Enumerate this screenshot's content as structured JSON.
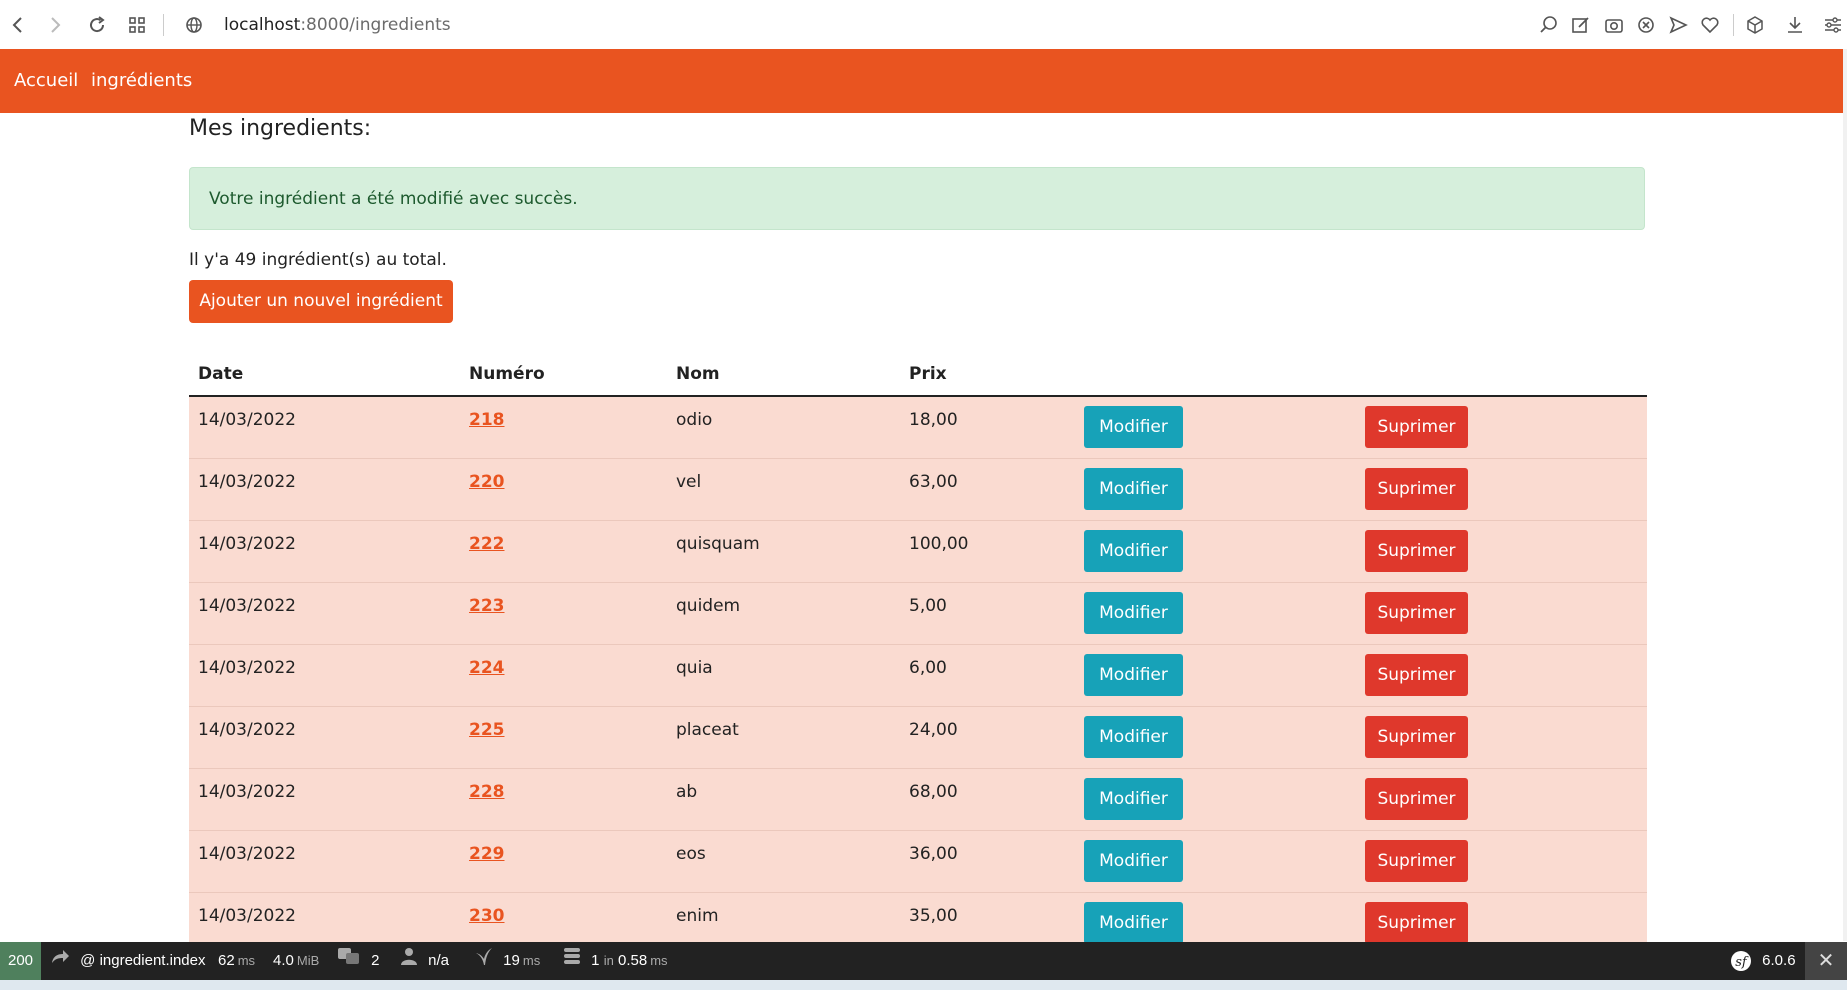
{
  "browser": {
    "url_host": "localhost",
    "url_path": ":8000/ingredients",
    "icons": [
      "back-icon",
      "forward-icon",
      "reload-icon",
      "tabs-grid-icon",
      "globe-icon",
      "zoom-icon",
      "edit-icon",
      "camera-icon",
      "close-circle-icon",
      "send-icon",
      "heart-icon",
      "box-icon",
      "download-icon",
      "settings-sliders-icon"
    ]
  },
  "navbar": {
    "links": [
      {
        "label": "Accueil"
      },
      {
        "label": "ingrédients"
      }
    ]
  },
  "page": {
    "heading": "Mes ingredients:",
    "alert": "Votre ingrédient a été modifié avec succès.",
    "total": "Il y'a 49 ingrédient(s) au total.",
    "add_button": "Ajouter un nouvel ingrédient"
  },
  "table": {
    "headers": [
      "Date",
      "Numéro",
      "Nom",
      "Prix"
    ],
    "edit_label": "Modifier",
    "delete_label": "Suprimer",
    "rows": [
      {
        "date": "14/03/2022",
        "numero": "218",
        "nom": "odio",
        "prix": "18,00"
      },
      {
        "date": "14/03/2022",
        "numero": "220",
        "nom": "vel",
        "prix": "63,00"
      },
      {
        "date": "14/03/2022",
        "numero": "222",
        "nom": "quisquam",
        "prix": "100,00"
      },
      {
        "date": "14/03/2022",
        "numero": "223",
        "nom": "quidem",
        "prix": "5,00"
      },
      {
        "date": "14/03/2022",
        "numero": "224",
        "nom": "quia",
        "prix": "6,00"
      },
      {
        "date": "14/03/2022",
        "numero": "225",
        "nom": "placeat",
        "prix": "24,00"
      },
      {
        "date": "14/03/2022",
        "numero": "228",
        "nom": "ab",
        "prix": "68,00"
      },
      {
        "date": "14/03/2022",
        "numero": "229",
        "nom": "eos",
        "prix": "36,00"
      },
      {
        "date": "14/03/2022",
        "numero": "230",
        "nom": "enim",
        "prix": "35,00"
      }
    ]
  },
  "debug_toolbar": {
    "status": "200",
    "route": "@ ingredient.index",
    "time_value": "62",
    "time_unit": "ms",
    "memory_value": "4.0",
    "memory_unit": "MiB",
    "translations": "2",
    "user": "n/a",
    "twig_value": "19",
    "twig_unit": "ms",
    "db_value": "1",
    "db_in": "in",
    "db_time": "0.58",
    "db_unit": "ms",
    "version": "6.0.6",
    "colors": {
      "bg": "#222222",
      "status_ok": "#4f805d"
    }
  },
  "colors": {
    "primary": "#e95420",
    "info": "#17a2b8",
    "danger": "#df382c",
    "row_bg": "#fadbd1",
    "alert_bg": "#d6efdc"
  }
}
